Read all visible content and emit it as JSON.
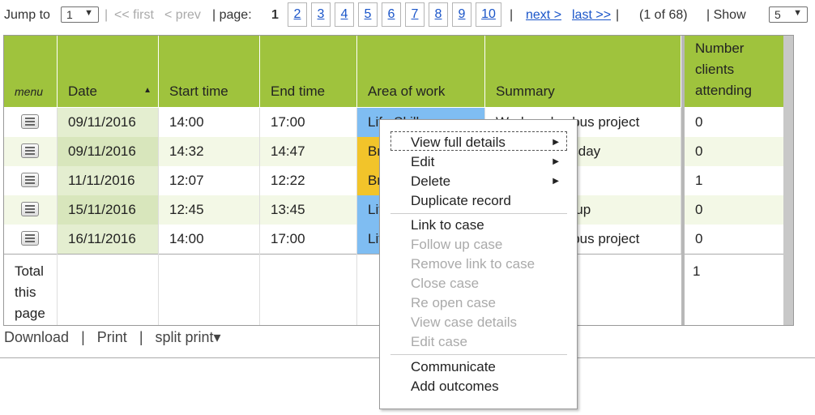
{
  "pager": {
    "jump_to_label": "Jump to",
    "jump_value": "1",
    "first_label": "<< first",
    "prev_label": "< prev",
    "page_label": "| page:",
    "current_page": "1",
    "pages": [
      "2",
      "3",
      "4",
      "5",
      "6",
      "7",
      "8",
      "9",
      "10"
    ],
    "next_label": "next >",
    "last_label": "last >>",
    "count_text": "(1 of 68)",
    "show_label": "| Show",
    "show_value": "5"
  },
  "table": {
    "headers": {
      "menu": "menu",
      "date": "Date",
      "start": "Start time",
      "end": "End time",
      "area": "Area of work",
      "summary": "Summary",
      "clients": "Number clients attending"
    },
    "sort_indicator": "▲",
    "rows": [
      {
        "date": "09/11/2016",
        "start": "14:00",
        "end": "17:00",
        "area": "Life Skills",
        "summary": "Wednesday bus project",
        "clients": "0"
      },
      {
        "date": "09/11/2016",
        "start": "14:32",
        "end": "14:47",
        "area": "Breakfast club",
        "summary": "Club Wednesday",
        "clients": "0"
      },
      {
        "date": "11/11/2016",
        "start": "12:07",
        "end": "12:22",
        "area": "Breakfast club",
        "summary": "",
        "clients": "1"
      },
      {
        "date": "15/11/2016",
        "start": "12:45",
        "end": "13:45",
        "area": "Life Skills",
        "summary": "Life skills group",
        "clients": "0"
      },
      {
        "date": "16/11/2016",
        "start": "14:00",
        "end": "17:00",
        "area": "Life Skills",
        "summary": "Wednesday bus project",
        "clients": "0"
      }
    ],
    "total_label": "Total this page",
    "total_clients": "1"
  },
  "bottom": {
    "download": "Download",
    "sep1": "|",
    "print": "Print",
    "sep2": "|",
    "split_print": "split print▾"
  },
  "context_menu": {
    "items": [
      {
        "label": "View full details",
        "submenu": true,
        "disabled": false
      },
      {
        "label": "Edit",
        "submenu": true,
        "disabled": false
      },
      {
        "label": "Delete",
        "submenu": true,
        "disabled": false
      },
      {
        "label": "Duplicate record",
        "submenu": false,
        "disabled": false
      },
      {
        "label": "Link to case",
        "submenu": false,
        "disabled": false
      },
      {
        "label": "Follow up case",
        "submenu": false,
        "disabled": true
      },
      {
        "label": "Remove link to case",
        "submenu": false,
        "disabled": true
      },
      {
        "label": "Close case",
        "submenu": false,
        "disabled": true
      },
      {
        "label": "Re open case",
        "submenu": false,
        "disabled": true
      },
      {
        "label": "View case details",
        "submenu": false,
        "disabled": true
      },
      {
        "label": "Edit case",
        "submenu": false,
        "disabled": true
      },
      {
        "label": "Communicate",
        "submenu": false,
        "disabled": false
      },
      {
        "label": "Add outcomes",
        "submenu": false,
        "disabled": false
      }
    ],
    "submenu_arrow": "▶"
  },
  "colors": {
    "header_green": "#9fc33d",
    "area_life_skills": "#7fbdf2",
    "area_breakfast_club": "#f2c42a",
    "link_blue": "#1a55c9"
  }
}
